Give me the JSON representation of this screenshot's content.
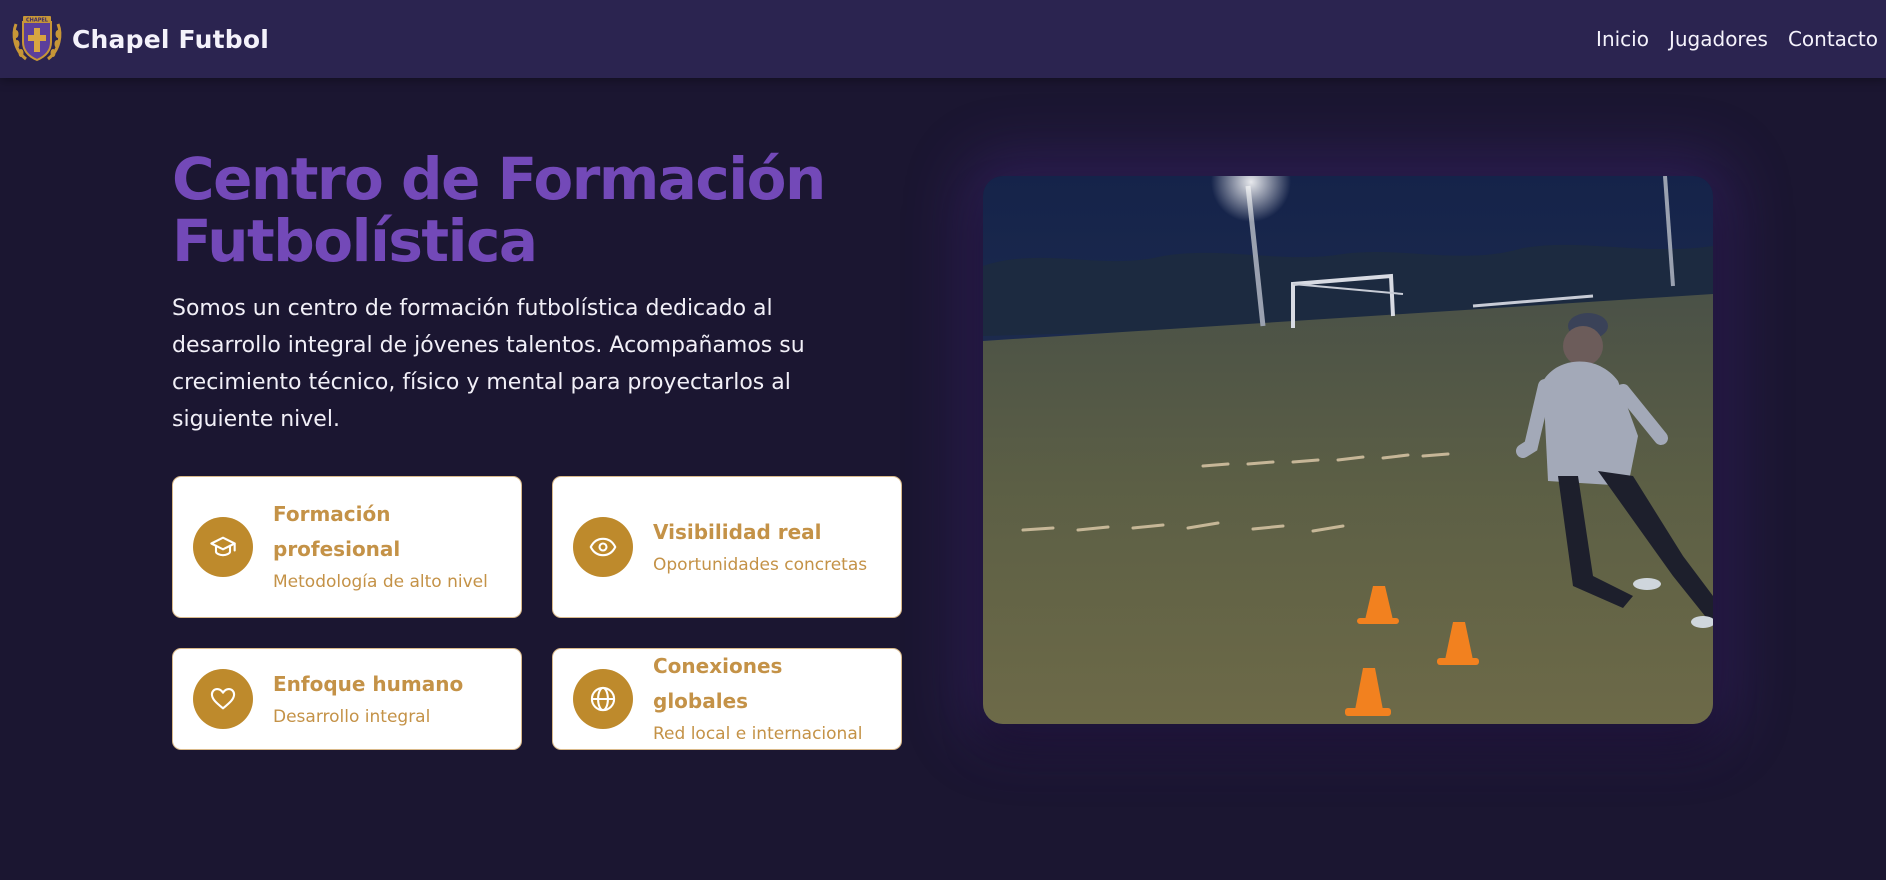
{
  "navbar": {
    "brand_name": "Chapel Futbol",
    "logo_text": "CHAPEL",
    "links": [
      "Inicio",
      "Jugadores",
      "Contacto"
    ]
  },
  "hero": {
    "title_line1": "Centro de Formación",
    "title_line2": "Futbolística",
    "description": "Somos un centro de formación futbolística dedicado al desarrollo integral de jóvenes talentos. Acompañamos su crecimiento técnico, físico y mental para proyectarlos al siguiente nivel."
  },
  "features": [
    {
      "icon": "graduation-cap-icon",
      "title": "Formación profesional",
      "subtitle": "Metodología de alto nivel"
    },
    {
      "icon": "eye-icon",
      "title": "Visibilidad real",
      "subtitle": "Oportunidades concretas"
    },
    {
      "icon": "heart-icon",
      "title": "Enfoque humano",
      "subtitle": "Desarrollo integral"
    },
    {
      "icon": "globe-icon",
      "title": "Conexiones globales",
      "subtitle": "Red local e internacional"
    }
  ],
  "colors": {
    "background": "#1b1631",
    "navbar": "#2b2450",
    "title_purple": "#7349b8",
    "accent_gold": "#be8a2c",
    "card_text_gold": "#c49247"
  }
}
